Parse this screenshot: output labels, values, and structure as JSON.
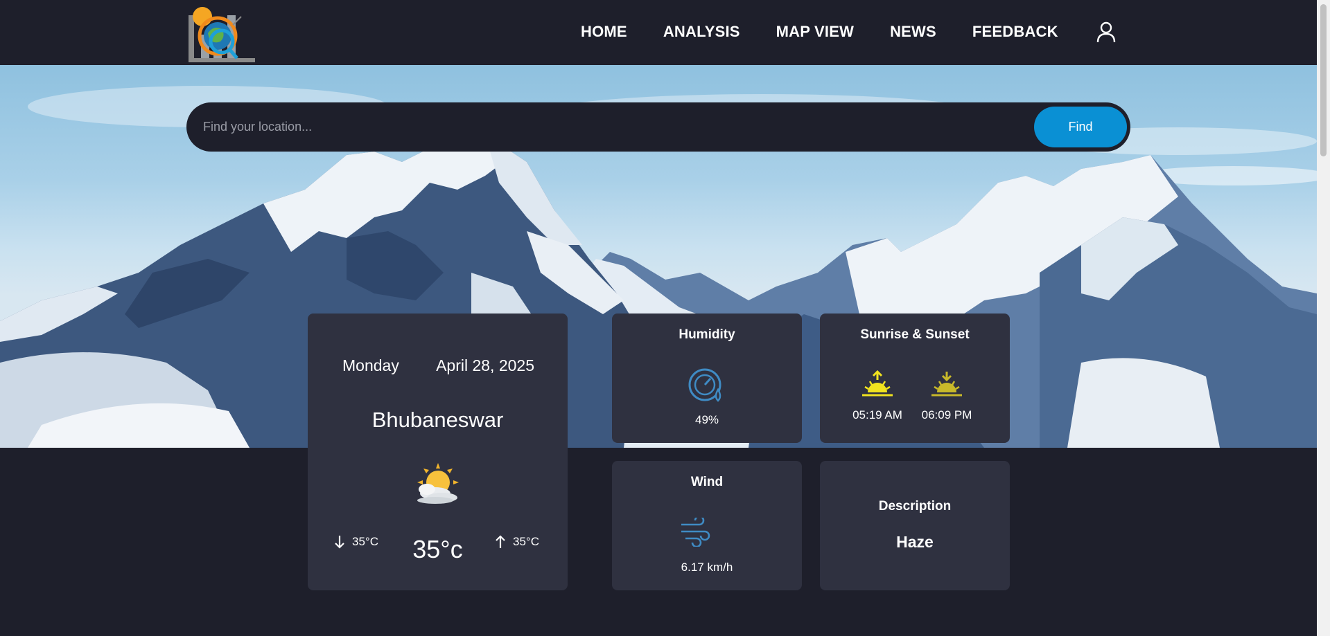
{
  "nav": {
    "links": [
      "HOME",
      "ANALYSIS",
      "MAP VIEW",
      "NEWS",
      "FEEDBACK"
    ]
  },
  "search": {
    "placeholder": "Find your location...",
    "button_label": "Find"
  },
  "weather": {
    "day": "Monday",
    "date": "April 28, 2025",
    "city": "Bhubaneswar",
    "temp_min": "35°C",
    "temp_current": "35°c",
    "temp_max": "35°C",
    "icon": "partly-cloudy-sun-icon"
  },
  "humidity": {
    "title": "Humidity",
    "value": "49%",
    "icon": "humidity-gauge-icon"
  },
  "sun": {
    "title": "Sunrise & Sunset",
    "sunrise": "05:19 AM",
    "sunset": "06:09 PM",
    "sunrise_color": "#f1e31f",
    "sunset_color": "#c8b92a"
  },
  "wind": {
    "title": "Wind",
    "value": "6.17 km/h",
    "icon": "wind-icon"
  },
  "description": {
    "title": "Description",
    "value": "Haze"
  },
  "colors": {
    "background": "#1e1f2b",
    "card": "#2f3140",
    "accent": "#0a90d4",
    "icon_blue": "#3f8bc4"
  }
}
